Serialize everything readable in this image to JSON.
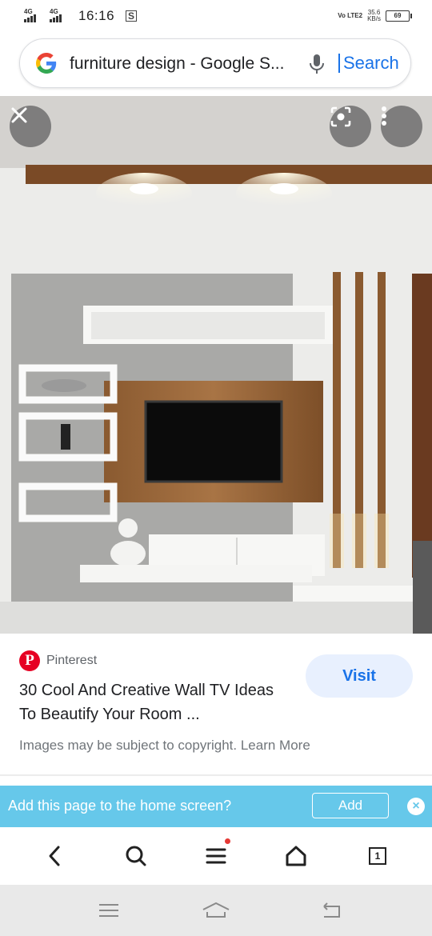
{
  "status_bar": {
    "net1": "4G",
    "net2": "4G",
    "time": "16:16",
    "volte": "Vo LTE2",
    "speed_value": "35.6",
    "speed_unit": "KB/s",
    "battery": "69"
  },
  "search": {
    "query": "furniture design - Google S...",
    "link_label": "Search"
  },
  "result": {
    "source": "Pinterest",
    "title": "30 Cool And Creative Wall TV Ideas To Beautify Your Room ...",
    "visit_label": "Visit",
    "copyright": "Images may be subject to copyright. Learn More"
  },
  "banner": {
    "text": "Add this page to the home screen?",
    "add_label": "Add"
  },
  "toolbar": {
    "tab_count": "1"
  },
  "colors": {
    "accent_blue": "#1a73e8",
    "banner_bg": "#66c8ea",
    "pinterest_red": "#e60023"
  }
}
